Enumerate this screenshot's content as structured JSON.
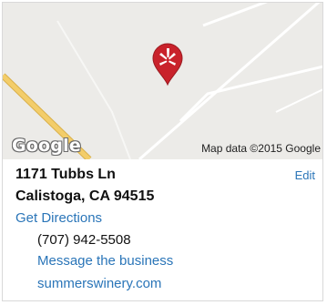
{
  "map": {
    "provider_logo": "Google",
    "attribution": "Map data ©2015 Google",
    "marker_icon": "yelp-burst-icon",
    "marker_color": "#c9222b"
  },
  "business": {
    "street": "1171 Tubbs Ln",
    "city_state_zip": "Calistoga, CA 94515",
    "edit_label": "Edit",
    "directions_label": "Get Directions",
    "phone": "(707) 942-5508",
    "message_label": "Message the business",
    "website": "summerswinery.com"
  },
  "colors": {
    "link": "#2a75b8",
    "road_highlight": "#f3cd6a"
  }
}
